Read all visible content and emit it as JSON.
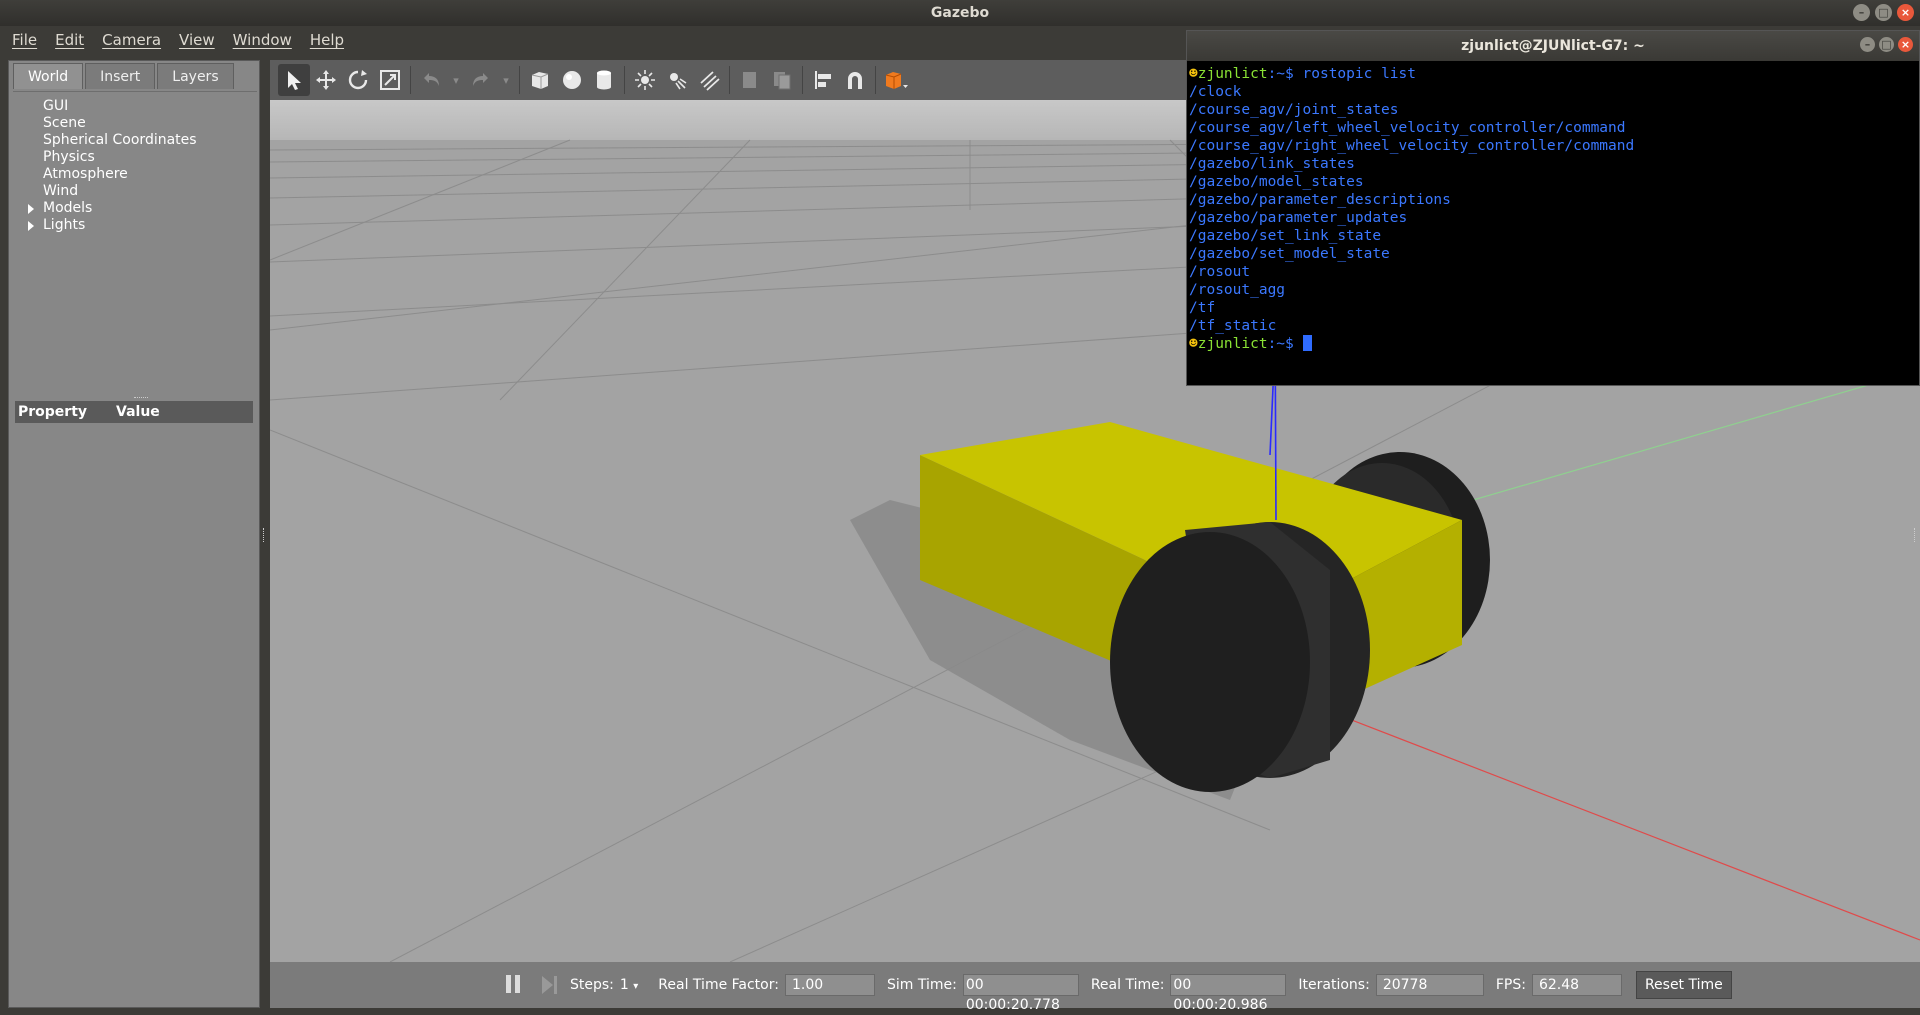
{
  "window": {
    "title": "Gazebo"
  },
  "menu": [
    "File",
    "Edit",
    "Camera",
    "View",
    "Window",
    "Help"
  ],
  "left_panel": {
    "tabs": [
      "World",
      "Insert",
      "Layers"
    ],
    "active_tab": "World",
    "tree": [
      {
        "label": "GUI",
        "expandable": false
      },
      {
        "label": "Scene",
        "expandable": false
      },
      {
        "label": "Spherical Coordinates",
        "expandable": false
      },
      {
        "label": "Physics",
        "expandable": false
      },
      {
        "label": "Atmosphere",
        "expandable": false
      },
      {
        "label": "Wind",
        "expandable": false
      },
      {
        "label": "Models",
        "expandable": true
      },
      {
        "label": "Lights",
        "expandable": true
      }
    ],
    "property_header": {
      "property": "Property",
      "value": "Value"
    }
  },
  "toolbar": {
    "icons": [
      "select-arrow-icon",
      "translate-icon",
      "rotate-icon",
      "scale-icon",
      "undo-icon",
      "redo-icon",
      "box-icon",
      "sphere-icon",
      "cylinder-icon",
      "point-light-icon",
      "spot-light-icon",
      "directional-light-icon",
      "copy-icon",
      "paste-icon",
      "align-icon",
      "snap-icon",
      "view-angle-icon"
    ]
  },
  "bottom_bar": {
    "steps_label": "Steps:",
    "steps_value": "1",
    "real_time_factor_label": "Real Time Factor:",
    "real_time_factor": "1.00",
    "sim_time_label": "Sim Time:",
    "sim_time": "00 00:00:20.778",
    "real_time_label": "Real Time:",
    "real_time": "00 00:00:20.986",
    "iterations_label": "Iterations:",
    "iterations": "20778",
    "fps_label": "FPS:",
    "fps": "62.48",
    "reset_label": "Reset Time"
  },
  "terminal": {
    "title": "zjunlict@ZJUNlict-G7: ~",
    "prompt_user": "zjunlict",
    "prompt_path": ":~$ ",
    "command": "rostopic list",
    "topics": [
      "/clock",
      "/course_agv/joint_states",
      "/course_agv/left_wheel_velocity_controller/command",
      "/course_agv/right_wheel_velocity_controller/command",
      "/gazebo/link_states",
      "/gazebo/model_states",
      "/gazebo/parameter_descriptions",
      "/gazebo/parameter_updates",
      "/gazebo/set_link_state",
      "/gazebo/set_model_state",
      "/rosout",
      "/rosout_agg",
      "/tf",
      "/tf_static"
    ]
  },
  "colors": {
    "robot_body": "#c8c400",
    "wheel": "#262626",
    "ground": "#a3a3a3",
    "terminal_text": "#3b78ff"
  }
}
